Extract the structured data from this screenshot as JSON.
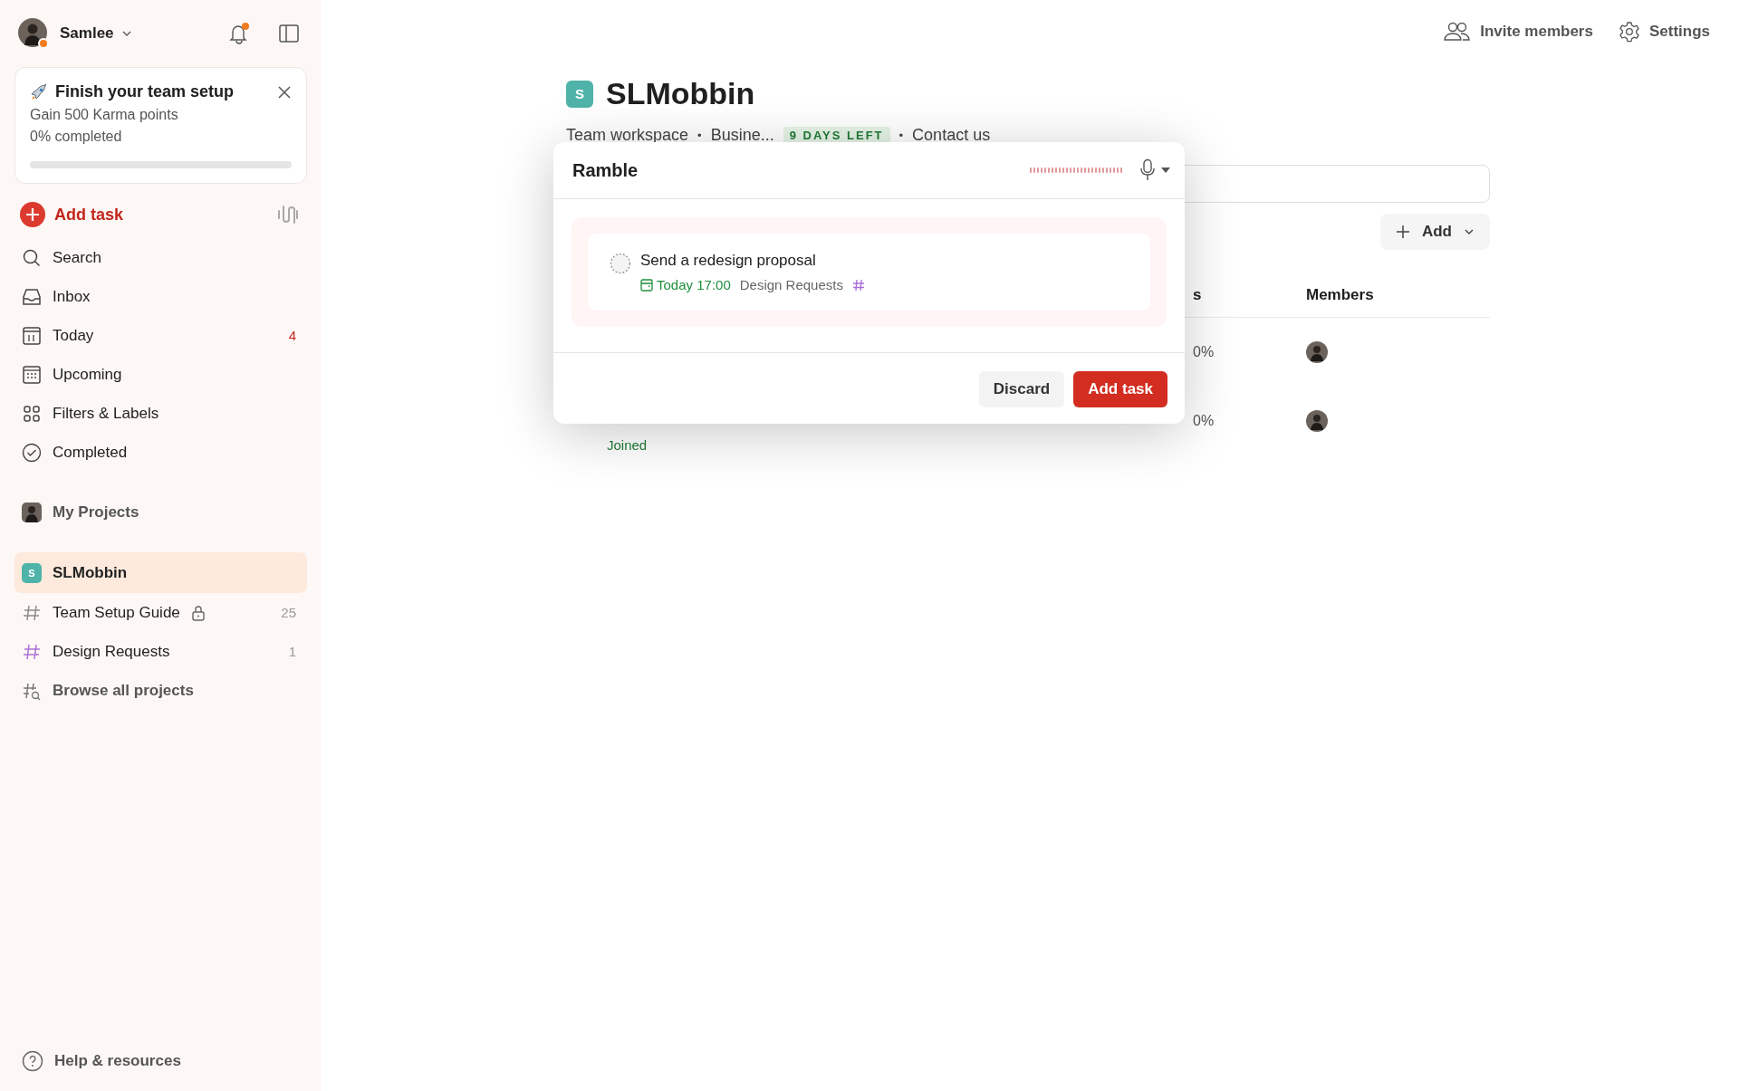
{
  "sidebar": {
    "user": {
      "name": "Samlee"
    },
    "setup_card": {
      "title": "Finish your team setup",
      "subtitle": "Gain 500 Karma points",
      "progress_text": "0% completed",
      "level": 0
    },
    "add_task": "Add task",
    "nav": [
      {
        "label": "Search"
      },
      {
        "label": "Inbox"
      },
      {
        "label": "Today",
        "count": "4"
      },
      {
        "label": "Upcoming"
      },
      {
        "label": "Filters & Labels"
      },
      {
        "label": "Completed"
      }
    ],
    "my_projects": "My Projects",
    "projects": [
      {
        "kind": "workspace",
        "label": "SLMobbin",
        "badge": "S",
        "selected": true
      },
      {
        "kind": "project",
        "label": "Team Setup Guide",
        "locked": true,
        "count": "25",
        "color": "#8a8a8a",
        "selected": false
      },
      {
        "kind": "project",
        "label": "Design Requests",
        "locked": false,
        "count": "1",
        "color": "#a970d6",
        "selected": false
      },
      {
        "kind": "browse",
        "label": "Browse all projects",
        "selected": false
      }
    ],
    "help": "Help & resources"
  },
  "top_actions": [
    {
      "kind": "invite",
      "label": "Invite members"
    },
    {
      "kind": "settings",
      "label": "Settings"
    }
  ],
  "project": {
    "badge": "S",
    "title": "SLMobbin",
    "workspace": "Team workspace",
    "separator": "•",
    "plan": "Busine...",
    "trial_badge": "9 DAYS LEFT",
    "contact": "Contact us"
  },
  "add_button": "Add",
  "table": {
    "columns": [
      "s",
      "Members"
    ],
    "rows": [
      {
        "progress": "0%"
      },
      {
        "status": "Joined",
        "progress": "0%"
      }
    ]
  },
  "ramble": {
    "title": "Ramble",
    "task": {
      "checked": false,
      "title": "Send a redesign proposal",
      "due": "Today 17:00",
      "project": "Design Requests"
    },
    "buttons": [
      {
        "kind": "secondary",
        "label": "Discard"
      },
      {
        "kind": "primary",
        "label": "Add task"
      }
    ]
  }
}
